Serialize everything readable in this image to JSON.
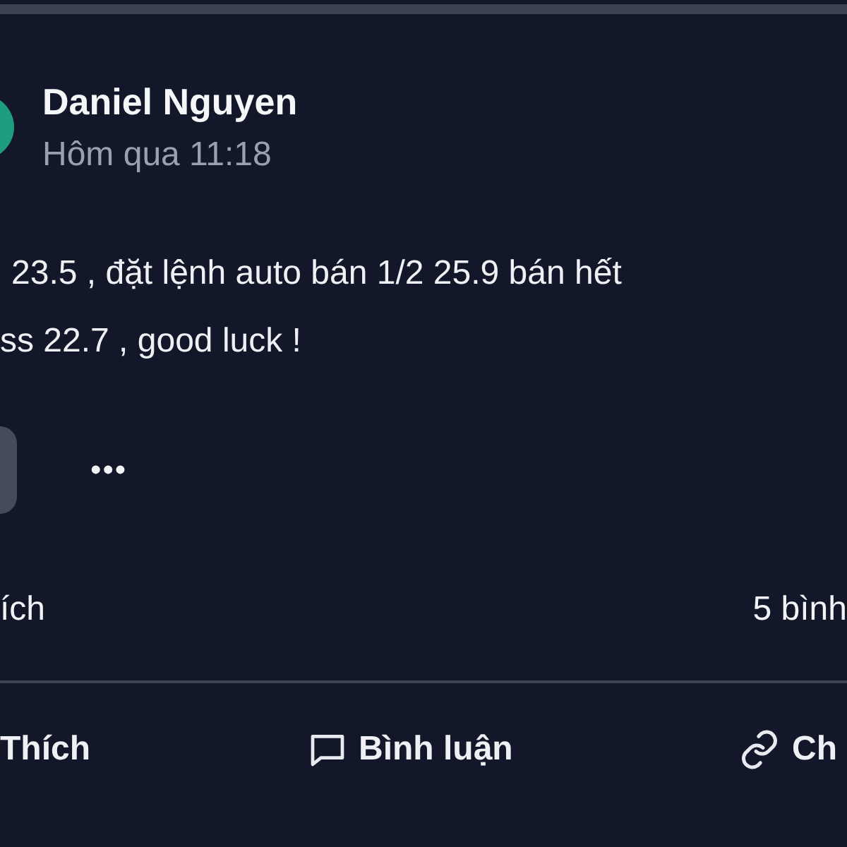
{
  "post": {
    "author": "Daniel Nguyen",
    "time": "Hôm qua 11:18",
    "lines": [
      "23.5 , đặt lệnh auto bán 1/2 25.9 bán hết",
      "ss 22.7 , good luck !"
    ],
    "more": "•••",
    "likes": "ích",
    "comments": "5 bình",
    "actions": [
      {
        "kind": "like",
        "label": "Thích"
      },
      {
        "kind": "comment",
        "label": "Bình luận"
      },
      {
        "kind": "share",
        "label": "Ch"
      }
    ]
  }
}
